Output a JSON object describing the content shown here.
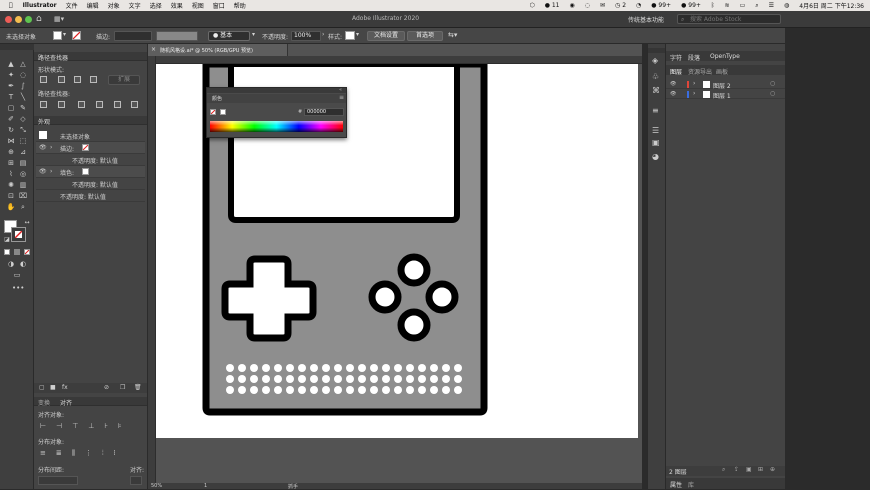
{
  "menubar": {
    "app": "Illustrator",
    "items": [
      "文件",
      "编辑",
      "对象",
      "文字",
      "选择",
      "效果",
      "视图",
      "窗口",
      "帮助"
    ],
    "status": {
      "wechat_count": "11",
      "badge_2": "2",
      "badge_99a": "99+",
      "badge_99b": "99+",
      "datetime": "4月6日 周二 下午12:36"
    }
  },
  "titlebar": {
    "title": "Adobe Illustrator 2020",
    "workspace": "传统基本功能",
    "search_placeholder": "搜索 Adobe Stock"
  },
  "control": {
    "no_selection": "未选择对象",
    "stroke_label": "描边:",
    "brush_label": "基本",
    "opacity_label": "不透明度:",
    "opacity_value": "100%",
    "style_label": "样式:",
    "doc_setup": "文档设置",
    "preferences": "首选项"
  },
  "colors": {
    "accent": "#2d74d8",
    "artboard": "#ffffff",
    "device_body": "#8e8e8e",
    "device_stroke": "#000000",
    "panel": "#444444"
  },
  "left_panel": {
    "pathfinder_title": "路径查找器",
    "shape_modes": "形状模式:",
    "expand": "扩展",
    "pathfinders": "路径查找器:",
    "appearance_title": "外观",
    "no_selection": "未选择对象",
    "stroke": "描边:",
    "opacity_default_1": "不透明度: 默认值",
    "fill": "填色:",
    "opacity_default_2": "不透明度: 默认值",
    "opacity_default_3": "不透明度: 默认值",
    "transform_tab": "变换",
    "align_tab": "对齐",
    "align_objects": "对齐对象:",
    "distribute_objects": "分布对象:",
    "distribute_spacing": "分布间距:",
    "align_to": "对齐:"
  },
  "document": {
    "tab_title": "随机风格设.ai* @ 50% (RGB/GPU 预览)",
    "zoom": "50%",
    "page": "1",
    "tool_status": "抓手"
  },
  "color_panel": {
    "title": "颜色",
    "hex_value": "000000"
  },
  "right_panel": {
    "tabs": [
      "字符",
      "段落",
      "OpenType"
    ],
    "subtabs": [
      "图层",
      "资源导出",
      "画板"
    ],
    "layers": [
      {
        "name": "图层 2",
        "color": "#e0463a"
      },
      {
        "name": "图层 1",
        "color": "#3a6de0"
      }
    ],
    "layer_count": "2 图层",
    "bottom_tabs": [
      "属性",
      "库"
    ]
  }
}
